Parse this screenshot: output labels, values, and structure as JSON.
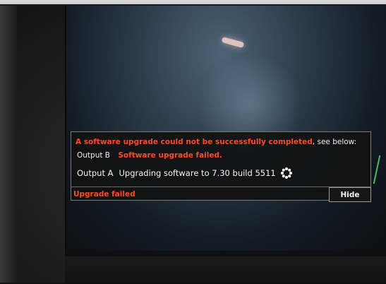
{
  "dialog": {
    "message_error": "A software upgrade could not be successfully completed",
    "message_suffix": ", see below:",
    "output_b_label": "Output B",
    "output_b_status": "Software upgrade failed.",
    "output_a_label": "Output A",
    "output_a_status": "Upgrading software to 7.30 build 5511",
    "spinner_icon": "spinner-icon"
  },
  "status_bar": {
    "status_text": "Upgrade failed",
    "hide_label": "Hide"
  },
  "colors": {
    "error": "#ff4a2a",
    "text": "#f0f0f0",
    "dialog_background": "#121212",
    "border": "#7a7a7a"
  }
}
